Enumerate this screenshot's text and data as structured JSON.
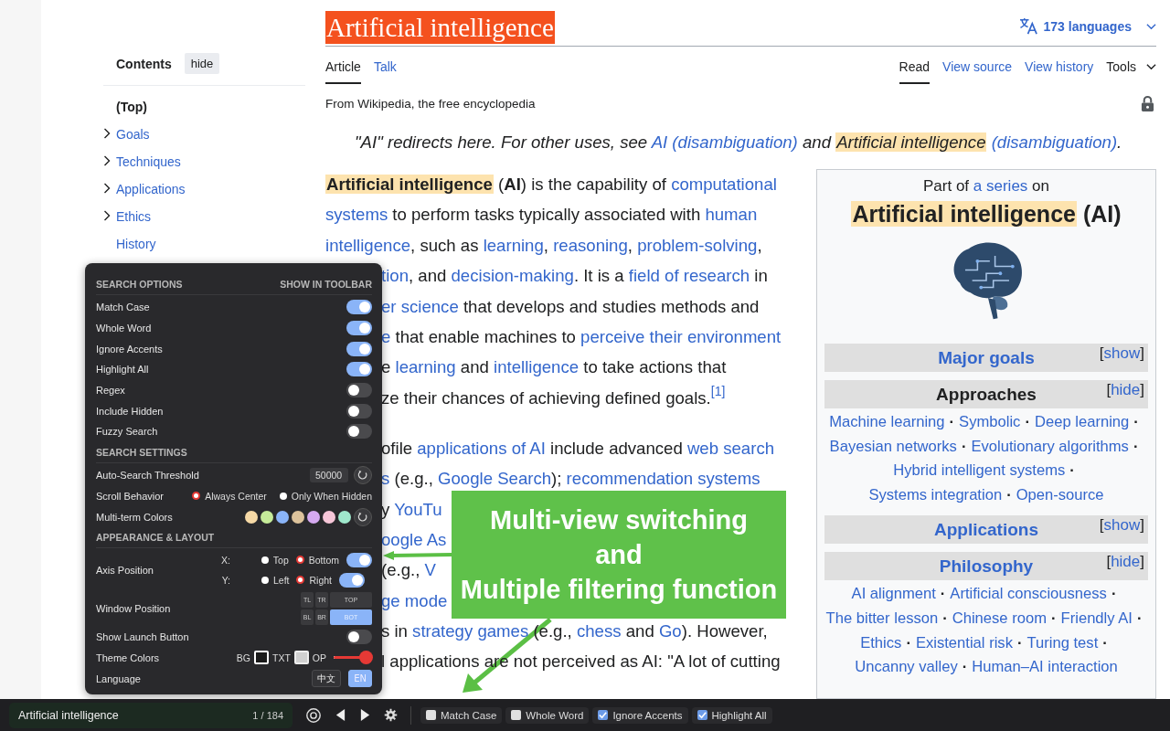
{
  "languages": {
    "label": "173 languages"
  },
  "title": "Artificial intelligence",
  "page_tabs": [
    {
      "label": "Article",
      "selected": true
    },
    {
      "label": "Talk",
      "selected": false
    }
  ],
  "view_tabs": [
    {
      "label": "Read",
      "selected": true
    },
    {
      "label": "View source",
      "selected": false
    },
    {
      "label": "View history",
      "selected": false
    }
  ],
  "tools_menu": {
    "label": "Tools"
  },
  "tagline": "From Wikipedia, the free encyclopedia",
  "hatnote": [
    {
      "kind": "plain",
      "text": "\"AI\" redirects here. For other uses, see "
    },
    {
      "kind": "link",
      "text": "AI (disambiguation)"
    },
    {
      "kind": "plain",
      "text": " and "
    },
    {
      "kind": "mark",
      "text": "Artificial intelligence"
    },
    {
      "kind": "link",
      "text": " (disambiguation)"
    },
    {
      "kind": "plain",
      "text": "."
    }
  ],
  "contents": {
    "heading": "Contents",
    "toggle": "hide",
    "items": [
      {
        "label": "(Top)",
        "selected": true,
        "expandable": false
      },
      {
        "label": "Goals",
        "selected": false,
        "expandable": true
      },
      {
        "label": "Techniques",
        "selected": false,
        "expandable": true
      },
      {
        "label": "Applications",
        "selected": false,
        "expandable": true
      },
      {
        "label": "Ethics",
        "selected": false,
        "expandable": true
      },
      {
        "label": "History",
        "selected": false,
        "expandable": false
      }
    ]
  },
  "article": {
    "paragraphs": [
      {
        "lines": [
          {
            "segments": [
              {
                "kind": "mark_bold",
                "text": "Artificial intelligence"
              },
              {
                "kind": "plain",
                "text": " ("
              },
              {
                "kind": "bold",
                "text": "AI"
              },
              {
                "kind": "plain",
                "text": ") is the capability of "
              },
              {
                "kind": "link",
                "text": "computational"
              }
            ]
          },
          {
            "segments": [
              {
                "kind": "link",
                "text": "systems"
              },
              {
                "kind": "plain",
                "text": " to perform tasks typically associated with "
              },
              {
                "kind": "link",
                "text": "human"
              }
            ]
          },
          {
            "segments": [
              {
                "kind": "link",
                "text": "intelligence"
              },
              {
                "kind": "plain",
                "text": ", such as "
              },
              {
                "kind": "link",
                "text": "learning"
              },
              {
                "kind": "plain",
                "text": ", "
              },
              {
                "kind": "link",
                "text": "reasoning"
              },
              {
                "kind": "plain",
                "text": ", "
              },
              {
                "kind": "link",
                "text": "problem-solving"
              },
              {
                "kind": "plain",
                "text": ","
              }
            ]
          }
        ],
        "beside_panel": [
          {
            "segments": [
              {
                "kind": "link",
                "text": "tion"
              },
              {
                "kind": "plain",
                "text": ", and "
              },
              {
                "kind": "link",
                "text": "decision-making"
              },
              {
                "kind": "plain",
                "text": ". It is a "
              },
              {
                "kind": "link",
                "text": "field of research"
              },
              {
                "kind": "plain",
                "text": " in"
              }
            ]
          },
          {
            "segments": [
              {
                "kind": "link",
                "text": "er science"
              },
              {
                "kind": "plain",
                "text": " that develops and studies methods and"
              }
            ]
          },
          {
            "segments": [
              {
                "kind": "link",
                "text": "e"
              },
              {
                "kind": "plain",
                "text": " that enable machines to "
              },
              {
                "kind": "link",
                "text": "perceive their environment"
              }
            ]
          },
          {
            "segments": [
              {
                "kind": "plain",
                "text": "e "
              },
              {
                "kind": "link",
                "text": "learning"
              },
              {
                "kind": "plain",
                "text": " and "
              },
              {
                "kind": "link",
                "text": "intelligence"
              },
              {
                "kind": "plain",
                "text": " to take actions that"
              }
            ]
          },
          {
            "segments": [
              {
                "kind": "plain",
                "text": "ze their chances of achieving defined goals."
              },
              {
                "kind": "ref",
                "text": "[1]"
              }
            ]
          }
        ]
      },
      {
        "beside_panel": [
          {
            "segments": [
              {
                "kind": "plain",
                "text": "ofile "
              },
              {
                "kind": "link",
                "text": "applications of AI"
              },
              {
                "kind": "plain",
                "text": " include advanced "
              },
              {
                "kind": "link",
                "text": "web search"
              }
            ]
          },
          {
            "segments": [
              {
                "kind": "link",
                "text": "s"
              },
              {
                "kind": "plain",
                "text": " (e.g., "
              },
              {
                "kind": "link",
                "text": "Google Search"
              },
              {
                "kind": "plain",
                "text": "); "
              },
              {
                "kind": "link",
                "text": "recommendation systems"
              }
            ]
          },
          {
            "segments": [
              {
                "kind": "plain",
                "text": "y "
              },
              {
                "kind": "link",
                "text": "YouTu"
              }
            ]
          },
          {
            "segments": [
              {
                "kind": "link",
                "text": "oogle As"
              }
            ]
          },
          {
            "segments": [
              {
                "kind": "plain",
                "text": "(e.g., "
              },
              {
                "kind": "link",
                "text": "V"
              }
            ]
          },
          {
            "segments": [
              {
                "kind": "link",
                "text": "ge mode"
              }
            ]
          },
          {
            "segments": [
              {
                "kind": "plain",
                "text": "s in "
              },
              {
                "kind": "link",
                "text": "strategy games"
              },
              {
                "kind": "plain",
                "text": " (e.g., "
              },
              {
                "kind": "link",
                "text": "chess"
              },
              {
                "kind": "plain",
                "text": " and "
              },
              {
                "kind": "link",
                "text": "Go"
              },
              {
                "kind": "plain",
                "text": "). However,"
              }
            ]
          },
          {
            "segments": [
              {
                "kind": "plain",
                "text": "l applications are not perceived as AI: \"A lot of cutting"
              }
            ]
          }
        ]
      }
    ]
  },
  "infobox": {
    "intro": [
      {
        "kind": "plain",
        "text": "Part of "
      },
      {
        "kind": "link",
        "text": "a series"
      },
      {
        "kind": "plain",
        "text": " on"
      }
    ],
    "title": [
      {
        "kind": "mark",
        "text": "Artificial intelligence"
      },
      {
        "kind": "plain",
        "text": " (AI)"
      }
    ],
    "separator": "·",
    "bracket_open": "[",
    "bracket_close": "]",
    "sections": [
      {
        "title": "Major goals",
        "title_link": true,
        "toggle": "show"
      },
      {
        "title": "Approaches",
        "title_link": false,
        "toggle": "hide",
        "items": [
          "Machine learning",
          "Symbolic",
          "Deep learning",
          "Bayesian networks",
          "Evolutionary algorithms",
          "Hybrid intelligent systems",
          "Systems integration",
          "Open-source"
        ]
      },
      {
        "title": "Applications",
        "title_link": true,
        "toggle": "show"
      },
      {
        "title": "Philosophy",
        "title_link": true,
        "toggle": "hide",
        "items": [
          "AI alignment",
          "Artificial consciousness",
          "The bitter lesson",
          "Chinese room",
          "Friendly AI",
          "Ethics",
          "Existential risk",
          "Turing test",
          "Uncanny valley",
          "Human–AI interaction"
        ]
      }
    ]
  },
  "settings_panel": {
    "search_options": {
      "heading": "SEARCH OPTIONS",
      "column_heading": "SHOW IN TOOLBAR",
      "options": [
        {
          "label": "Match Case",
          "on": true
        },
        {
          "label": "Whole Word",
          "on": true
        },
        {
          "label": "Ignore Accents",
          "on": true
        },
        {
          "label": "Highlight All",
          "on": true
        },
        {
          "label": "Regex",
          "on": false
        },
        {
          "label": "Include Hidden",
          "on": false
        },
        {
          "label": "Fuzzy Search",
          "on": false
        }
      ]
    },
    "search_settings": {
      "heading": "SEARCH SETTINGS",
      "threshold": {
        "label": "Auto-Search Threshold",
        "value": "50000"
      },
      "scroll": {
        "label": "Scroll Behavior",
        "choices": [
          {
            "label": "Always Center",
            "selected": true
          },
          {
            "label": "Only When Hidden",
            "selected": false
          }
        ]
      },
      "colors": {
        "label": "Multi-term Colors",
        "swatches": [
          {
            "color": "#f6d9a6"
          },
          {
            "color": "#c5eb99"
          },
          {
            "color": "#8ab4f8"
          },
          {
            "color": "#dcc29b"
          },
          {
            "color": "#d5a9f0"
          },
          {
            "color": "#f6c6d8"
          },
          {
            "color": "#9fe8cc"
          }
        ]
      }
    },
    "appearance": {
      "heading": "APPEARANCE & LAYOUT",
      "axis": {
        "label": "Axis Position",
        "rows": [
          {
            "axis": "X:",
            "on": true,
            "choices": [
              {
                "label": "Top",
                "selected": false
              },
              {
                "label": "Bottom",
                "selected": true
              }
            ]
          },
          {
            "axis": "Y:",
            "on": true,
            "choices": [
              {
                "label": "Left",
                "selected": false
              },
              {
                "label": "Right",
                "selected": true
              }
            ]
          }
        ]
      },
      "window_position": {
        "label": "Window Position",
        "cells": [
          {
            "label": "TL",
            "selected": false
          },
          {
            "label": "TR",
            "selected": false
          },
          {
            "label": "TOP",
            "selected": false
          },
          {
            "label": "BL",
            "selected": false
          },
          {
            "label": "BR",
            "selected": false
          },
          {
            "label": "BOT",
            "selected": true
          }
        ]
      },
      "launch_button": {
        "label": "Show Launch Button",
        "on": false
      },
      "theme": {
        "label": "Theme Colors",
        "bg": "BG",
        "txt": "TXT",
        "op": "OP",
        "opacity": {
          "level": 0.85
        }
      },
      "language": {
        "label": "Language",
        "options": [
          {
            "label": "中文",
            "selected": false
          },
          {
            "label": "EN",
            "selected": true
          }
        ]
      }
    }
  },
  "callout": {
    "lines": [
      "Multi-view switching",
      "and",
      "Multiple filtering function"
    ]
  },
  "find_bar": {
    "query": "Artificial intelligence",
    "count": "1 / 184",
    "toggles": [
      {
        "label": "Match Case",
        "checked": false
      },
      {
        "label": "Whole Word",
        "checked": false
      },
      {
        "label": "Ignore Accents",
        "checked": true
      },
      {
        "label": "Highlight All",
        "checked": true
      }
    ]
  }
}
